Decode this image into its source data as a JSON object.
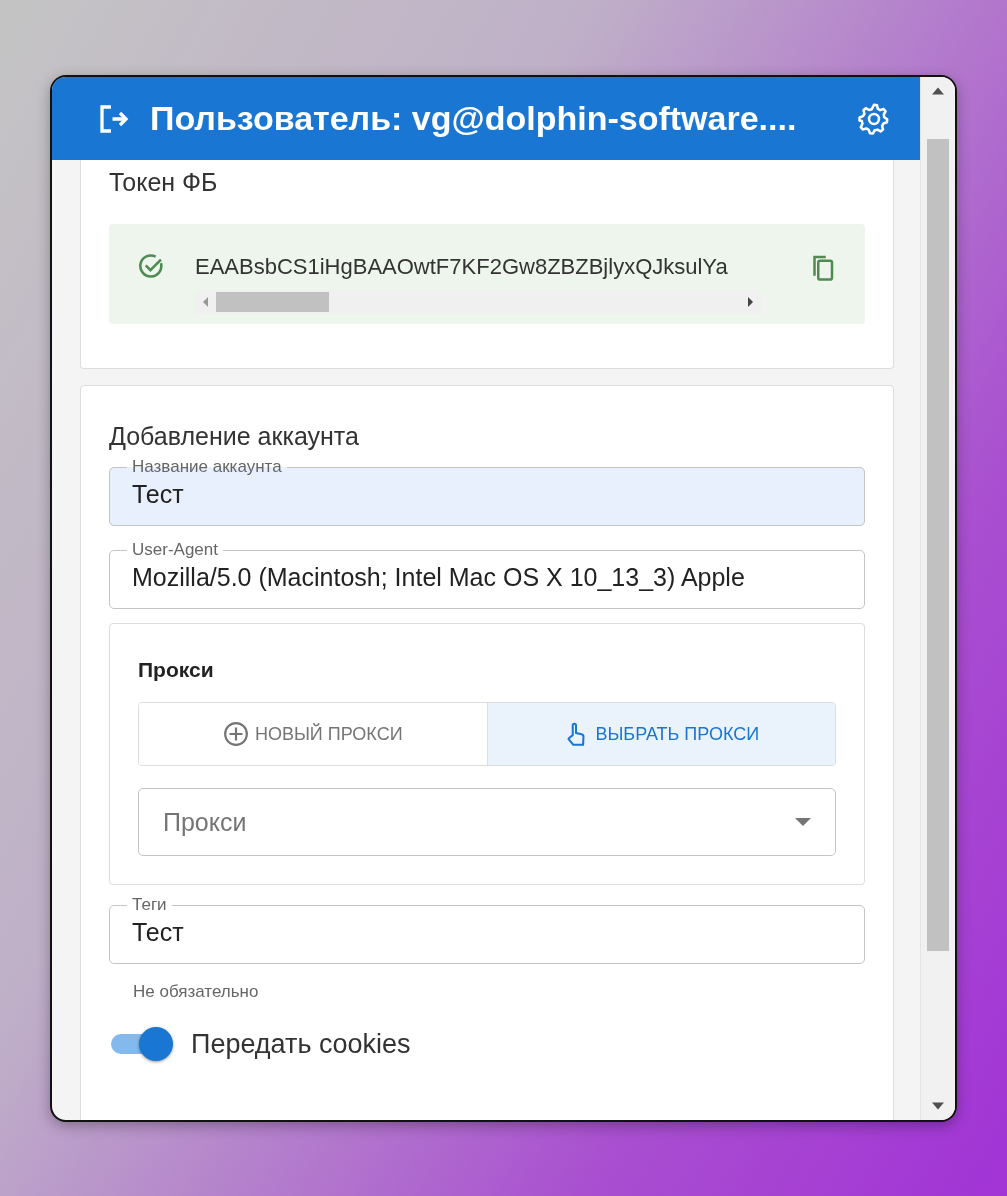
{
  "header": {
    "title": "Пользователь: vg@dolphin-software...."
  },
  "token": {
    "heading": "Токен ФБ",
    "value": "EAABsbCS1iHgBAAOwtF7KF2Gw8ZBZBjlyxQJksulYa",
    "valid": true
  },
  "account": {
    "heading": "Добавление аккаунта",
    "fields": [
      {
        "label": "Название аккаунта",
        "value": "Тест",
        "autofilled": true
      },
      {
        "label": "User-Agent",
        "value": "Mozilla/5.0 (Macintosh; Intel Mac OS X 10_13_3) Apple",
        "autofilled": false
      }
    ],
    "proxy": {
      "heading": "Прокси",
      "modes": [
        {
          "kind": "new",
          "label": "НОВЫЙ ПРОКСИ",
          "selected": false
        },
        {
          "kind": "pick",
          "label": "ВЫБРАТЬ ПРОКСИ",
          "selected": true
        }
      ],
      "select": {
        "placeholder": "Прокси"
      }
    },
    "tags": {
      "label": "Теги",
      "value": "Тест",
      "helper": "Не обязательно"
    },
    "cookies_switch": {
      "label": "Передать cookies",
      "on": true
    }
  }
}
